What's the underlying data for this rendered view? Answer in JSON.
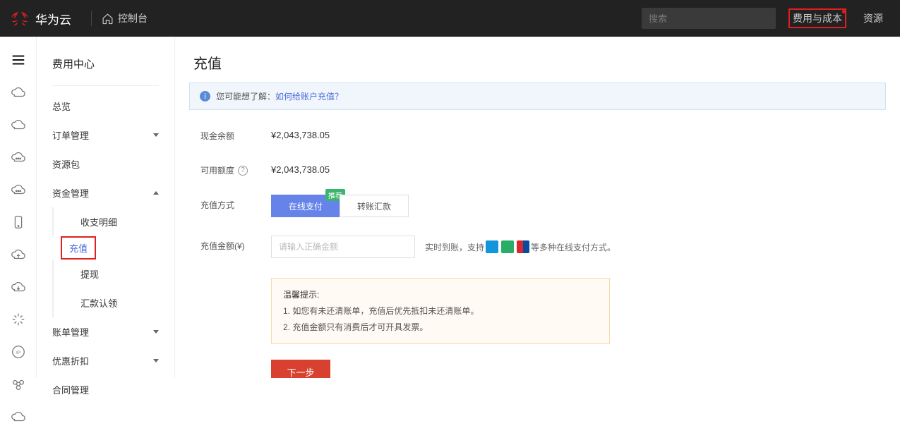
{
  "topbar": {
    "brand": "华为云",
    "console": "控制台",
    "search_placeholder": "搜索",
    "cost_link": "费用与成本",
    "resources_link": "资源"
  },
  "sidebar": {
    "title": "费用中心",
    "items": {
      "overview": "总览",
      "orders": "订单管理",
      "packages": "资源包",
      "funds": "资金管理",
      "funds_sub": {
        "detail": "收支明细",
        "recharge": "充值",
        "withdraw": "提现",
        "remit": "汇款认领"
      },
      "bills": "账单管理",
      "discount": "优惠折扣",
      "contract": "合同管理"
    }
  },
  "main": {
    "title": "充值",
    "info_prefix": "您可能想了解：",
    "info_link": "如何给账户充值？",
    "rows": {
      "cash_label": "现金余额",
      "cash_value": "¥2,043,738.05",
      "avail_label": "可用额度",
      "avail_value": "¥2,043,738.05",
      "method_label": "充值方式",
      "method_online": "在线支付",
      "method_badge": "推荐",
      "method_transfer": "转账汇款",
      "amount_label": "充值金额(¥)",
      "amount_placeholder": "请输入正确金额",
      "hint_pre": "实时到账，支持 ",
      "hint_post": " 等多种在线支付方式。"
    },
    "tips": {
      "title": "温馨提示:",
      "l1": "1. 如您有未还清账单，充值后优先抵扣未还清账单。",
      "l2": "2. 充值金额只有消费后才可开具发票。"
    },
    "next_btn": "下一步"
  }
}
